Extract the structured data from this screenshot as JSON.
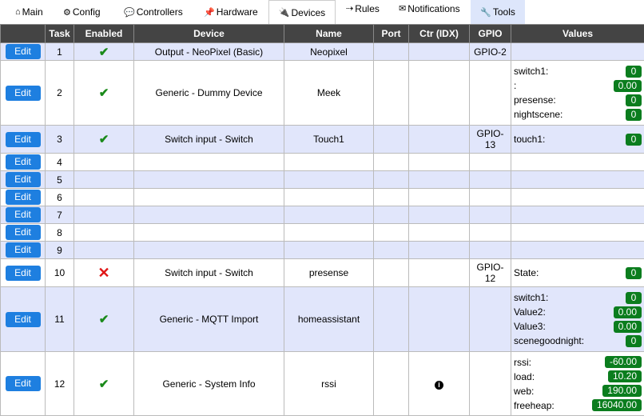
{
  "tabs": [
    {
      "icon": "⌂",
      "label": "Main",
      "name": "tab-main"
    },
    {
      "icon": "⚙",
      "label": "Config",
      "name": "tab-config"
    },
    {
      "icon": "💬",
      "label": "Controllers",
      "name": "tab-controllers"
    },
    {
      "icon": "📌",
      "label": "Hardware",
      "name": "tab-hardware"
    },
    {
      "icon": "🔌",
      "label": "Devices",
      "name": "tab-devices"
    },
    {
      "icon": "⇢",
      "label": "Rules",
      "name": "tab-rules"
    },
    {
      "icon": "✉",
      "label": "Notifications",
      "name": "tab-notifications"
    },
    {
      "icon": "🔧",
      "label": "Tools",
      "name": "tab-tools"
    }
  ],
  "table": {
    "headers": [
      "",
      "Task",
      "Enabled",
      "Device",
      "Name",
      "Port",
      "Ctr (IDX)",
      "GPIO",
      "Values"
    ],
    "edit_label": "Edit",
    "rows": [
      {
        "task": "1",
        "enabled": "check",
        "device": "Output - NeoPixel (Basic)",
        "name": "Neopixel",
        "port": "",
        "ctr": "",
        "gpio": [
          "GPIO-2"
        ],
        "values": []
      },
      {
        "task": "2",
        "enabled": "check",
        "device": "Generic - Dummy Device",
        "name": "Meek",
        "port": "",
        "ctr": "",
        "gpio": [],
        "values": [
          {
            "label": "switch1:",
            "value": "0"
          },
          {
            "label": ":",
            "value": "0.00"
          },
          {
            "label": "presense:",
            "value": "0"
          },
          {
            "label": "nightscene:",
            "value": "0"
          }
        ]
      },
      {
        "task": "3",
        "enabled": "check",
        "device": "Switch input - Switch",
        "name": "Touch1",
        "port": "",
        "ctr": "",
        "gpio": [
          "GPIO-",
          "13"
        ],
        "values": [
          {
            "label": "touch1:",
            "value": "0"
          }
        ]
      },
      {
        "task": "4",
        "enabled": "",
        "device": "",
        "name": "",
        "port": "",
        "ctr": "",
        "gpio": [],
        "values": []
      },
      {
        "task": "5",
        "enabled": "",
        "device": "",
        "name": "",
        "port": "",
        "ctr": "",
        "gpio": [],
        "values": []
      },
      {
        "task": "6",
        "enabled": "",
        "device": "",
        "name": "",
        "port": "",
        "ctr": "",
        "gpio": [],
        "values": []
      },
      {
        "task": "7",
        "enabled": "",
        "device": "",
        "name": "",
        "port": "",
        "ctr": "",
        "gpio": [],
        "values": []
      },
      {
        "task": "8",
        "enabled": "",
        "device": "",
        "name": "",
        "port": "",
        "ctr": "",
        "gpio": [],
        "values": []
      },
      {
        "task": "9",
        "enabled": "",
        "device": "",
        "name": "",
        "port": "",
        "ctr": "",
        "gpio": [],
        "values": []
      },
      {
        "task": "10",
        "enabled": "cross",
        "device": "Switch input - Switch",
        "name": "presense",
        "port": "",
        "ctr": "",
        "gpio": [
          "GPIO-",
          "12"
        ],
        "values": [
          {
            "label": "State:",
            "value": "0"
          }
        ]
      },
      {
        "task": "11",
        "enabled": "check",
        "device": "Generic - MQTT Import",
        "name": "homeassistant",
        "port": "",
        "ctr": "",
        "gpio": [],
        "values": [
          {
            "label": "switch1:",
            "value": "0"
          },
          {
            "label": "Value2:",
            "value": "0.00"
          },
          {
            "label": "Value3:",
            "value": "0.00"
          },
          {
            "label": "scenegoodnight:",
            "value": "0"
          }
        ]
      },
      {
        "task": "12",
        "enabled": "check",
        "device": "Generic - System Info",
        "name": "rssi",
        "port": "",
        "ctr": "info",
        "gpio": [],
        "values": [
          {
            "label": "rssi:",
            "value": "-60.00"
          },
          {
            "label": "load:",
            "value": "10.20"
          },
          {
            "label": "web:",
            "value": "190.00"
          },
          {
            "label": "freeheap:",
            "value": "16040.00"
          }
        ]
      }
    ]
  },
  "glyphs": {
    "check": "✔",
    "cross": "✕",
    "info": "i"
  },
  "colors": {
    "header_bg": "#444444",
    "row_shade": "#e1e6fb",
    "edit_button": "#1e7fe0",
    "value_badge": "#0b7d1e",
    "check": "#1a8a1a",
    "cross": "#e01515"
  }
}
